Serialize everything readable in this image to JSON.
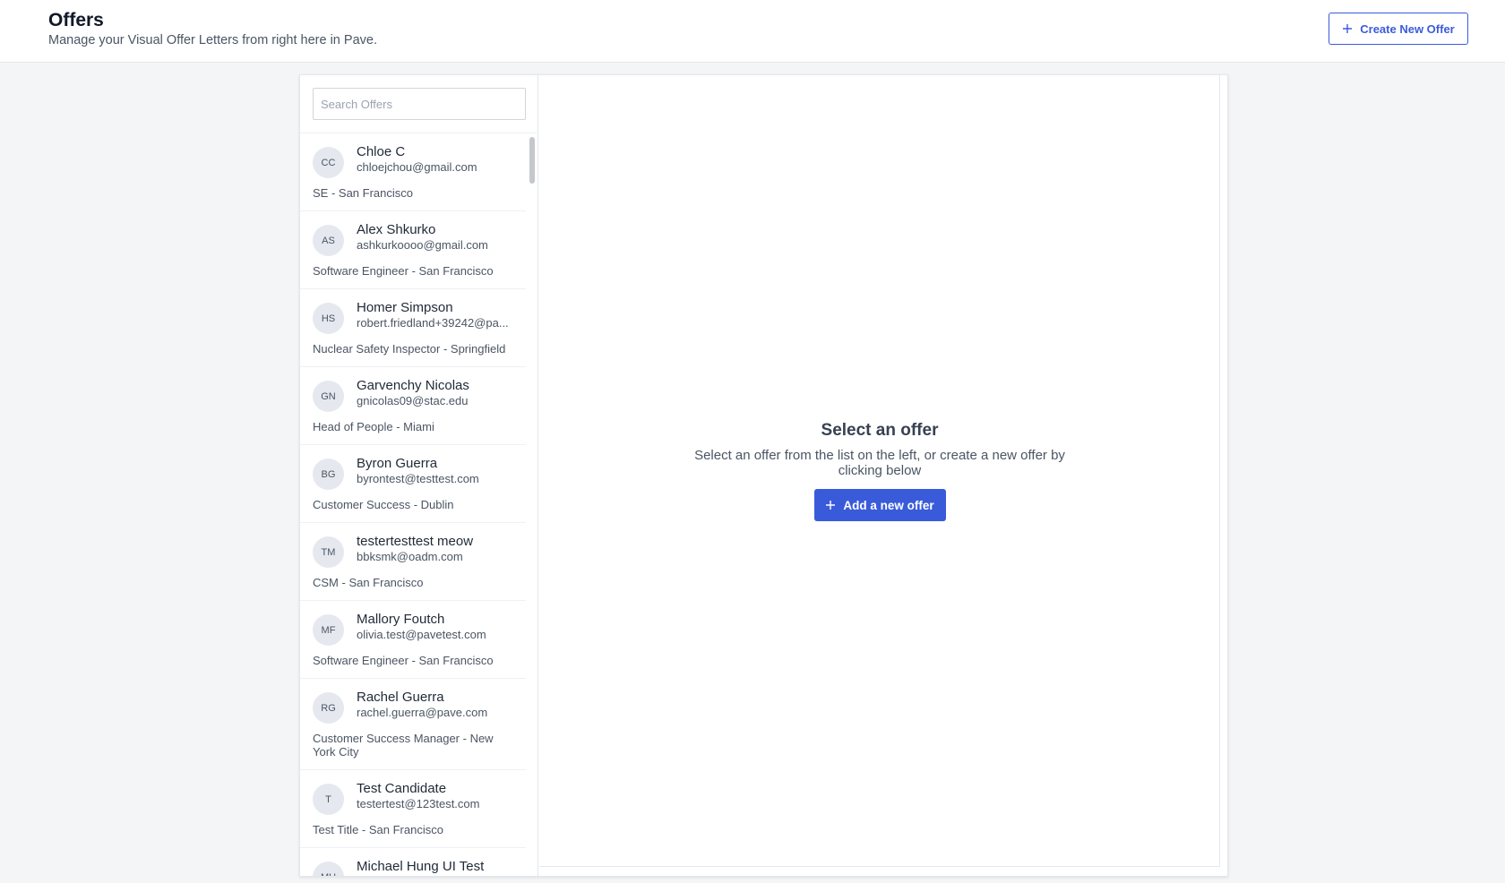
{
  "header": {
    "title": "Offers",
    "subtitle": "Manage your Visual Offer Letters from right here in Pave.",
    "create_label": "Create New Offer"
  },
  "search": {
    "placeholder": "Search Offers",
    "value": ""
  },
  "offers": [
    {
      "initials": "CC",
      "name": "Chloe C",
      "email": "chloejchou@gmail.com",
      "role": "SE - San Francisco"
    },
    {
      "initials": "AS",
      "name": "Alex Shkurko",
      "email": "ashkurkoooo@gmail.com",
      "role": "Software Engineer - San Francisco"
    },
    {
      "initials": "HS",
      "name": "Homer Simpson",
      "email": "robert.friedland+39242@pa...",
      "role": "Nuclear Safety Inspector - Springfield"
    },
    {
      "initials": "GN",
      "name": "Garvenchy Nicolas",
      "email": "gnicolas09@stac.edu",
      "role": "Head of People - Miami"
    },
    {
      "initials": "BG",
      "name": "Byron Guerra",
      "email": "byrontest@testtest.com",
      "role": "Customer Success - Dublin"
    },
    {
      "initials": "TM",
      "name": "testertesttest meow",
      "email": "bbksmk@oadm.com",
      "role": "CSM - San Francisco"
    },
    {
      "initials": "MF",
      "name": "Mallory Foutch",
      "email": "olivia.test@pavetest.com",
      "role": "Software Engineer - San Francisco"
    },
    {
      "initials": "RG",
      "name": "Rachel Guerra",
      "email": "rachel.guerra@pave.com",
      "role": "Customer Success Manager - New York City"
    },
    {
      "initials": "T",
      "name": "Test Candidate",
      "email": "testertest@123test.com",
      "role": "Test Title - San Francisco"
    },
    {
      "initials": "MH",
      "name": "Michael Hung UI Test",
      "email": "",
      "role": ""
    }
  ],
  "empty_state": {
    "title": "Select an offer",
    "description": "Select an offer from the list on the left, or create a new offer by clicking below",
    "button_label": "Add a new offer"
  },
  "colors": {
    "accent": "#3a5bd9",
    "page_bg": "#f4f5f7",
    "avatar_bg": "#e5e8ef"
  },
  "icons": {
    "create_button_icon": "plus-icon",
    "add_button_icon": "plus-icon"
  }
}
